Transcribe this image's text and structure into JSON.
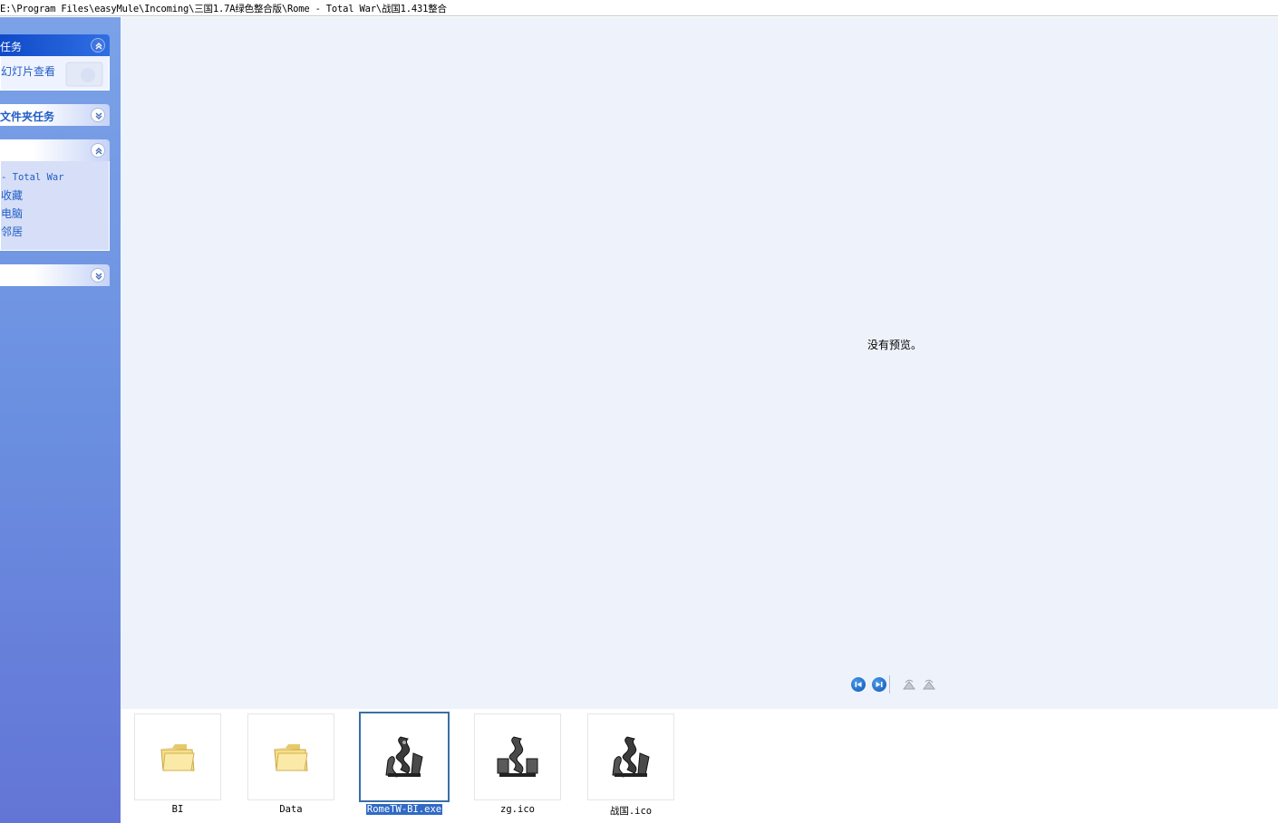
{
  "address": {
    "path": "E:\\Program Files\\easyMule\\Incoming\\三国1.7A绿色整合版\\Rome - Total War\\战国1.431整合"
  },
  "taskpane": {
    "picture_tasks": {
      "title": "任务",
      "items": [
        "幻灯片查看"
      ]
    },
    "folder_tasks": {
      "title": "文件夹任务"
    },
    "other_places": {
      "title": "",
      "items": [
        "- Total War",
        "收藏",
        "电脑",
        "邻居"
      ]
    },
    "details": {
      "title": ""
    }
  },
  "preview": {
    "message": "没有预览。",
    "controls": [
      "previous-image",
      "next-image",
      "rotate-clockwise",
      "rotate-counterclockwise"
    ]
  },
  "filmstrip": {
    "items": [
      {
        "label": "BI",
        "icon": "folder-icon",
        "selected": false
      },
      {
        "label": "Data",
        "icon": "folder-icon",
        "selected": false
      },
      {
        "label": "RomeTW-BI.exe",
        "icon": "dragon-icon",
        "selected": true
      },
      {
        "label": "zg.ico",
        "icon": "dragon-icon",
        "selected": false
      },
      {
        "label": "战国.ico",
        "icon": "dragon-icon",
        "selected": false
      }
    ]
  },
  "colors": {
    "accent": "#316ac5",
    "pane_top": "#7ba2e7",
    "pane_bottom": "#6375d6",
    "preview_bg": "#eef3fb",
    "link": "#215dc6"
  }
}
